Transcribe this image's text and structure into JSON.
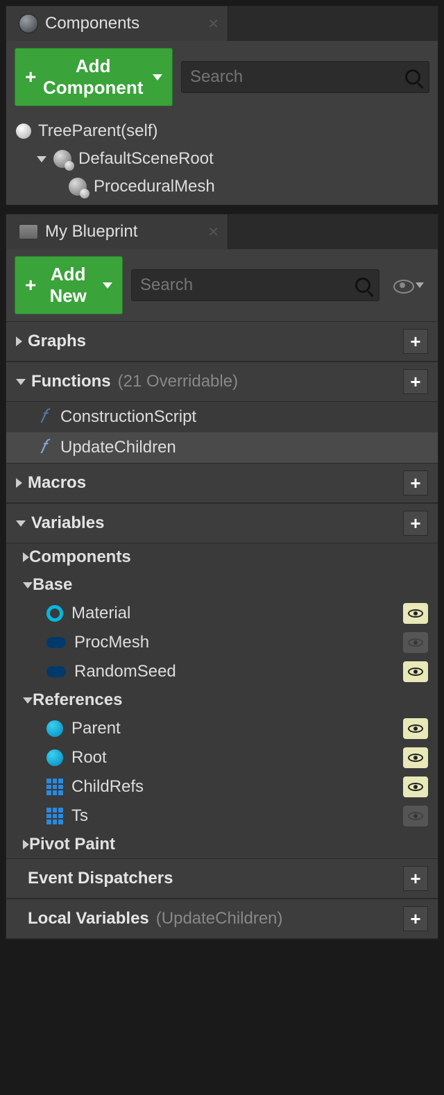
{
  "components_panel": {
    "title": "Components",
    "add_button": "Add Component",
    "search_placeholder": "Search",
    "tree": {
      "root": "TreeParent(self)",
      "scene_root": "DefaultSceneRoot",
      "child": "ProceduralMesh"
    }
  },
  "blueprint_panel": {
    "title": "My Blueprint",
    "add_button": "Add New",
    "search_placeholder": "Search",
    "graphs": {
      "label": "Graphs"
    },
    "functions": {
      "label": "Functions",
      "sub": "(21 Overridable)",
      "items": [
        {
          "name": "ConstructionScript",
          "native": true
        },
        {
          "name": "UpdateChildren",
          "native": false,
          "selected": true
        }
      ]
    },
    "macros": {
      "label": "Macros"
    },
    "variables": {
      "label": "Variables",
      "groups": [
        {
          "name": "Components",
          "expanded": false,
          "vars": []
        },
        {
          "name": "Base",
          "expanded": true,
          "vars": [
            {
              "name": "Material",
              "icon": "ring",
              "public": true
            },
            {
              "name": "ProcMesh",
              "icon": "pill",
              "public": false
            },
            {
              "name": "RandomSeed",
              "icon": "pill",
              "public": true
            }
          ]
        },
        {
          "name": "References",
          "expanded": true,
          "vars": [
            {
              "name": "Parent",
              "icon": "ball",
              "public": true
            },
            {
              "name": "Root",
              "icon": "ball",
              "public": true
            },
            {
              "name": "ChildRefs",
              "icon": "grid",
              "public": true
            },
            {
              "name": "Ts",
              "icon": "grid",
              "public": false
            }
          ]
        },
        {
          "name": "Pivot Paint",
          "expanded": false,
          "vars": []
        }
      ]
    },
    "event_dispatchers": {
      "label": "Event Dispatchers"
    },
    "local_variables": {
      "label": "Local Variables",
      "sub": "(UpdateChildren)"
    }
  }
}
